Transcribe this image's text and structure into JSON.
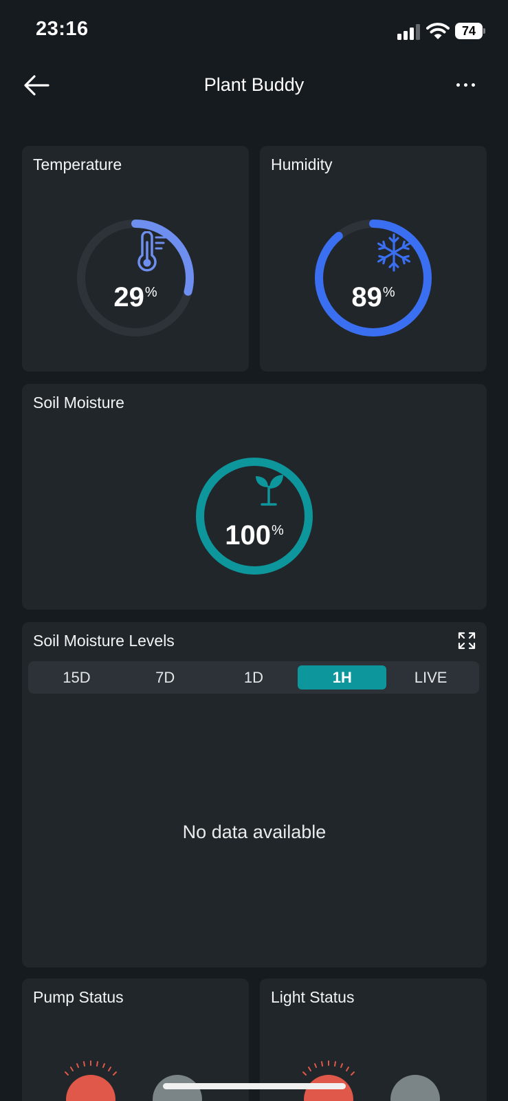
{
  "status_bar": {
    "time": "23:16",
    "battery": "74"
  },
  "header": {
    "title": "Plant Buddy"
  },
  "temperature": {
    "title": "Temperature",
    "value": "29",
    "unit": "%",
    "level": 0.29,
    "color": "#6f8ff0",
    "icon": "thermometer-icon"
  },
  "humidity": {
    "title": "Humidity",
    "value": "89",
    "unit": "%",
    "level": 0.89,
    "color": "#3a6ff2",
    "icon": "snowflake-icon"
  },
  "soil_moisture": {
    "title": "Soil Moisture",
    "value": "100",
    "unit": "%",
    "level": 1.0,
    "color": "#0d969b",
    "icon": "sprout-icon"
  },
  "levels": {
    "title": "Soil Moisture Levels",
    "tabs": [
      "15D",
      "7D",
      "1D",
      "1H",
      "LIVE"
    ],
    "active_tab": "1H",
    "empty_message": "No data available"
  },
  "pump_status": {
    "title": "Pump Status"
  },
  "light_status": {
    "title": "Light Status"
  },
  "colors": {
    "background": "#161b1f",
    "card": "#21262a",
    "accent": "#0d969b",
    "off_red": "#e0584a",
    "gray": "#7b8487"
  }
}
